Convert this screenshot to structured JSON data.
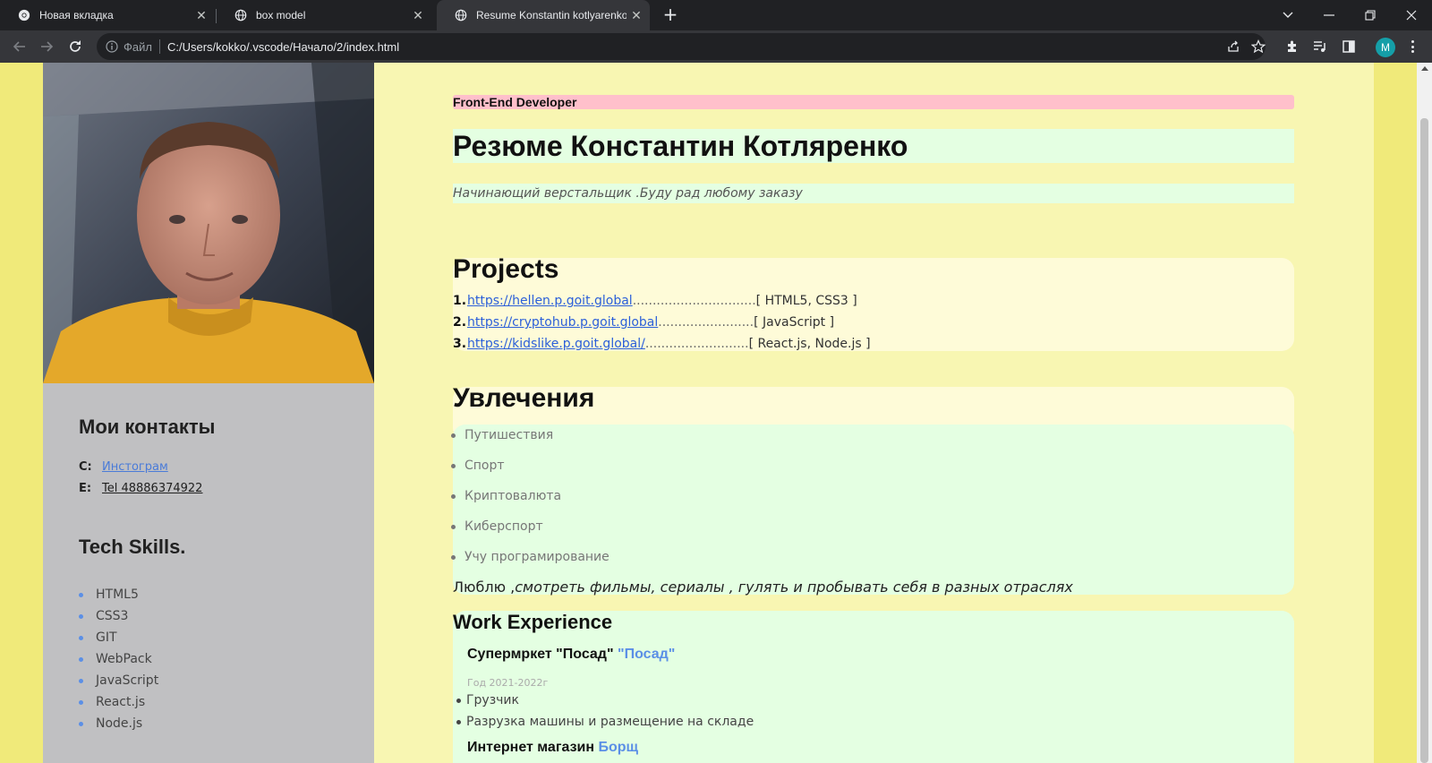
{
  "browser": {
    "tabs": [
      {
        "title": "Новая вкладка"
      },
      {
        "title": "box model"
      },
      {
        "title": "Resume Konstantin kotlyarenko"
      }
    ],
    "address": {
      "scheme": "Файл",
      "url": "C:/Users/kokko/.vscode/Начало/2/index.html"
    },
    "profile_initial": "M"
  },
  "page": {
    "role": "Front-End Developer",
    "title": "Резюме Константин Котляренко",
    "tagline": "Начинающий верстальщик .Буду рад любому заказу",
    "contacts": {
      "heading": "Мои контакты",
      "rows": [
        {
          "label": "C:",
          "text": "Инстограм"
        },
        {
          "label": "E:",
          "text": "Tel 48886374922"
        }
      ]
    },
    "skills": {
      "heading": "Tech Skills.",
      "items": [
        "HTML5",
        "CSS3",
        "GIT",
        "WebPack",
        "JavaScript",
        "React.js",
        "Node.js"
      ]
    },
    "projects": {
      "heading": "Projects",
      "items": [
        {
          "num": "1.",
          "url": "https://hellen.p.goit.global",
          "dots": " ...............................",
          "tech": "[ HTML5, CSS3 ]"
        },
        {
          "num": "2.",
          "url": "https://cryptohub.p.goit.global",
          "dots": " ........................ ",
          "tech": "[ JavaScript ]"
        },
        {
          "num": "3.",
          "url": "https://kidslike.p.goit.global/",
          "dots": " ..........................",
          "tech": "[ React.js, Node.js ]"
        }
      ]
    },
    "hobbies": {
      "heading": "Увлечения",
      "items": [
        "Путишествия",
        "Спорт",
        "Криптовалюта",
        "Киберспорт",
        "Учу програмирование"
      ],
      "note_plain": "Люблю ,",
      "note_italic": "смотреть фильмы, сериалы , гулять и пробывать себя в разных отраслях"
    },
    "work": {
      "heading": "Work Experience",
      "job1": {
        "title": "Супермркет \"Посад\"",
        "brand": "\"Посад\"",
        "date": "Год 2021-2022г",
        "duties": [
          "Грузчик",
          "Разрузка машины и размещение на складе"
        ]
      },
      "job2": {
        "title": "Интернет магазин",
        "brand": "Борщ"
      }
    }
  },
  "colors": {
    "outer_bg": "#f0ea7a",
    "main_bg": "#f8f6b2",
    "sidebar_bg": "#c0c0c2",
    "pink": "#ffc0cb",
    "mint": "#e4ffe2",
    "cream": "#fefbd8",
    "accent": "#5b8fe6"
  },
  "icons": [
    "chrome-icon",
    "globe-icon",
    "close-icon",
    "plus-icon",
    "back-icon",
    "forward-icon",
    "reload-icon",
    "info-icon",
    "share-icon",
    "star-icon",
    "extensions-icon",
    "media-icon",
    "side-panel-icon",
    "menu-icon"
  ]
}
